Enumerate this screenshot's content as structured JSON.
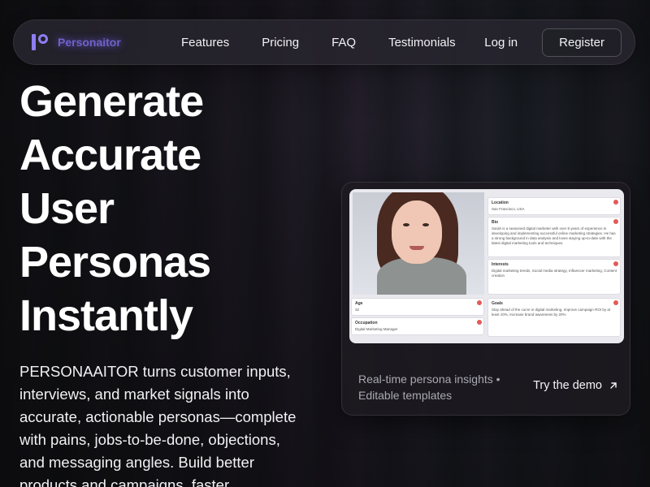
{
  "nav": {
    "brand": "Personaitor",
    "links": [
      "Features",
      "Pricing",
      "FAQ",
      "Testimonials"
    ],
    "login": "Log in",
    "register": "Register"
  },
  "hero": {
    "headline_lines": [
      "Generate",
      "Accurate",
      "User",
      "Personas",
      "Instantly"
    ],
    "subcopy": "PERSONAAITOR turns customer inputs, interviews, and market signals into accurate, actionable personas—complete with pains, jobs-to-be-done, objections, and messaging angles. Build better products and campaigns, faster."
  },
  "demo": {
    "persona": {
      "location_label": "Location",
      "location_value": "San Francisco, USA",
      "bio_label": "Bio",
      "bio_value": "Sarah is a seasoned digital marketer with over 8 years of experience in developing and implementing successful online marketing strategies. He has a strong background in data analysis and loves staying up-to-date with the latest digital marketing tools and techniques.",
      "interests_label": "Interests",
      "interests_value": "Digital marketing trends, Social media strategy, Influencer marketing, Content creation",
      "age_label": "Age",
      "age_value": "32",
      "goals_label": "Goals",
      "goals_value": "Stay ahead of the curve in digital marketing, Improve campaign ROI by at least 10%, Increase brand awareness by 20%",
      "occupation_label": "Occupation",
      "occupation_value": "Digital Marketing Manager"
    },
    "meta_text": "Real-time persona insights • Editable templates",
    "cta": "Try the demo"
  },
  "colors": {
    "accent": "#8d7ef0",
    "background": "#121216",
    "card": "#1c1a20"
  }
}
